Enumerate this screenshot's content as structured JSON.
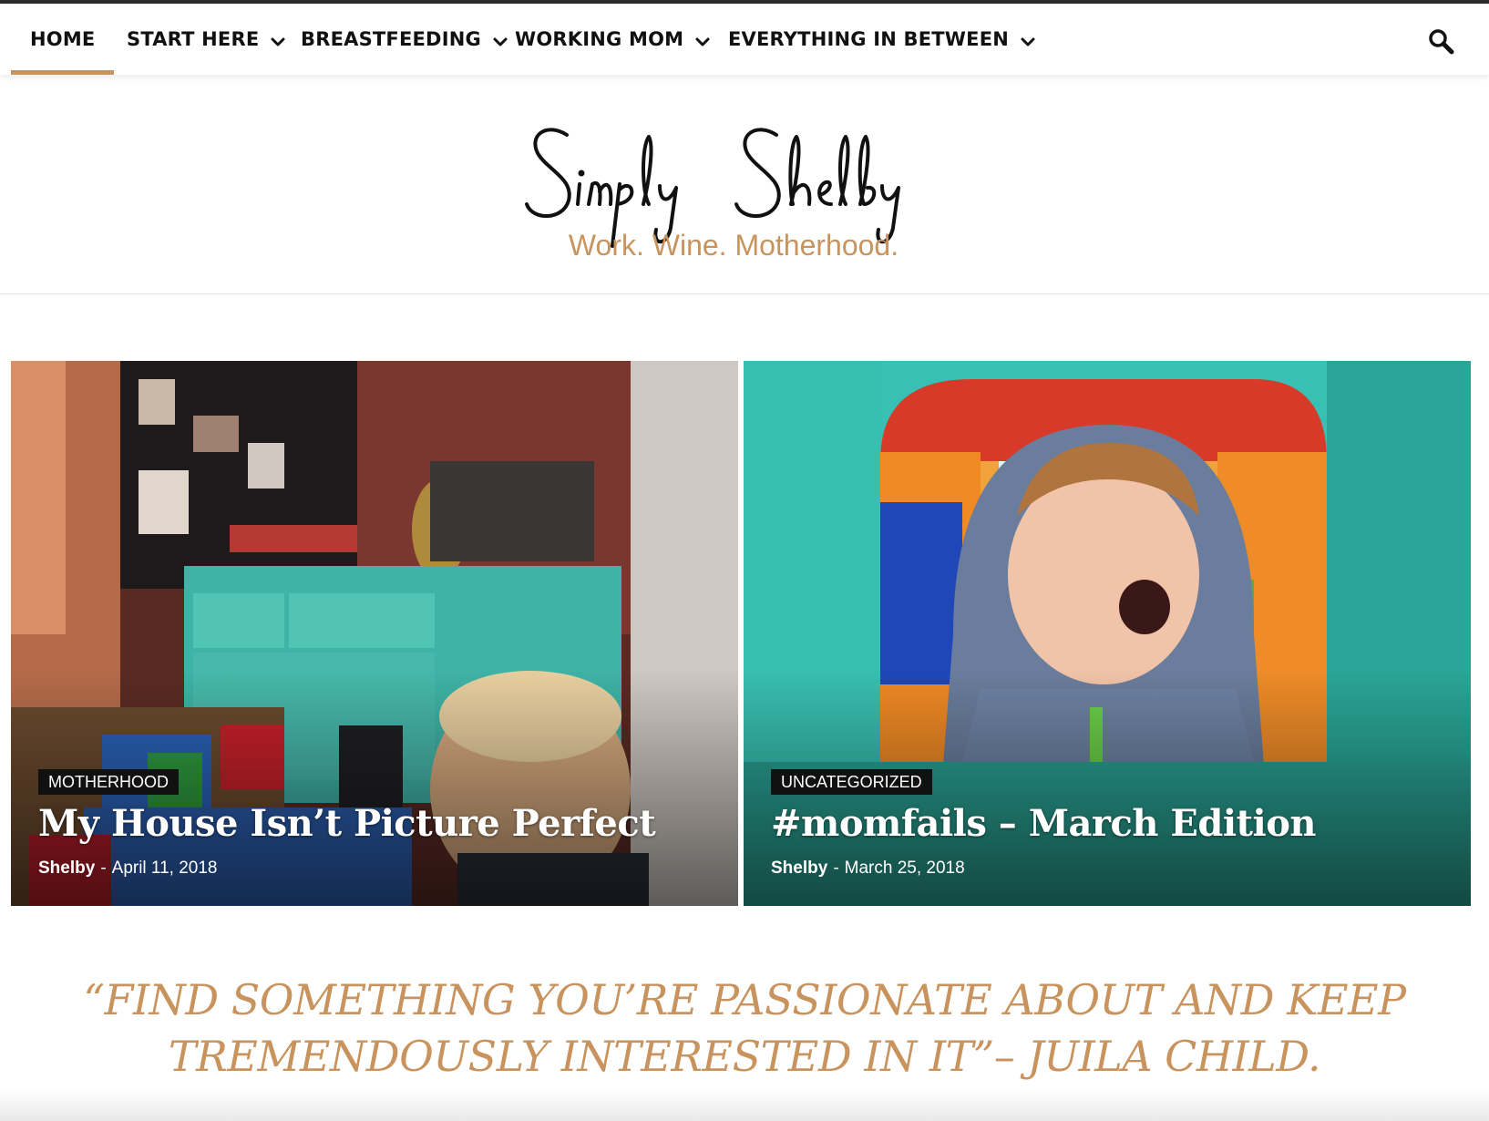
{
  "nav": {
    "items": [
      {
        "label": "HOME",
        "has_dropdown": false,
        "active": true
      },
      {
        "label": "START HERE",
        "has_dropdown": true,
        "active": false
      },
      {
        "label": "BREASTFEEDING",
        "has_dropdown": true,
        "active": false
      },
      {
        "label": "WORKING MOM",
        "has_dropdown": true,
        "active": false
      },
      {
        "label": "EVERYTHING IN BETWEEN",
        "has_dropdown": true,
        "active": false
      }
    ],
    "search_icon": "search-icon"
  },
  "logo": {
    "title": "Simply Shelby",
    "tagline": "Work. Wine. Motherhood."
  },
  "featured": [
    {
      "category": "MOTHERHOOD",
      "title": "My House Isn’t Picture Perfect",
      "author": "Shelby",
      "separator": "-",
      "date": "April 11, 2018"
    },
    {
      "category": "UNCATEGORIZED",
      "title": "#momfails – March Edition",
      "author": "Shelby",
      "separator": "-",
      "date": "March 25, 2018"
    }
  ],
  "quote": {
    "line1": "“FIND SOMETHING YOU’RE PASSIONATE ABOUT AND KEEP",
    "line2": "TREMENDOUSLY INTERESTED IN IT”– JUILA CHILD."
  },
  "colors": {
    "accent": "#c8935d",
    "nav_text": "#111111",
    "badge_bg": "#111111"
  }
}
